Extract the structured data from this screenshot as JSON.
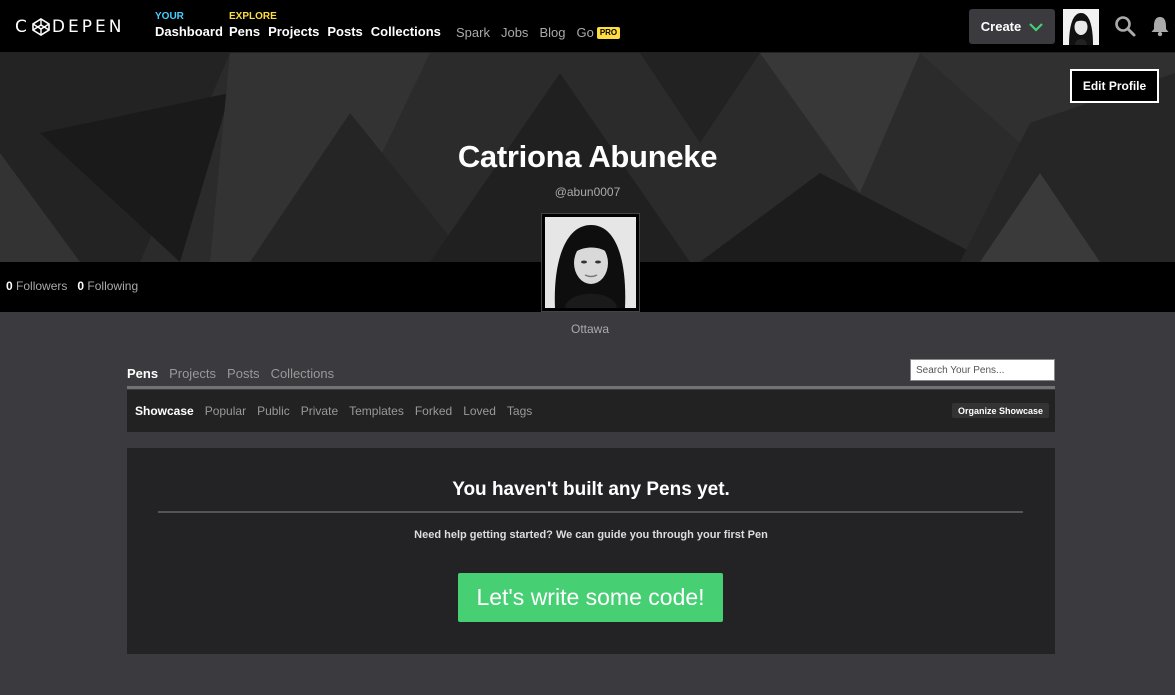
{
  "brand": {
    "logo_text_left": "C",
    "logo_text_right": "DEPEN"
  },
  "nav": {
    "your": {
      "kicker": "YOUR",
      "links": [
        "Dashboard"
      ]
    },
    "explore": {
      "kicker": "EXPLORE",
      "links": [
        "Pens",
        "Projects",
        "Posts",
        "Collections"
      ]
    },
    "secondary": [
      "Spark",
      "Jobs",
      "Blog",
      "Go"
    ],
    "pro_badge": "PRO",
    "create_label": "Create"
  },
  "profile": {
    "edit_label": "Edit Profile",
    "name": "Catriona Abuneke",
    "handle": "@abun0007",
    "followers_count": "0",
    "followers_label": "Followers",
    "following_count": "0",
    "following_label": "Following",
    "location": "Ottawa"
  },
  "content": {
    "tabs": [
      "Pens",
      "Projects",
      "Posts",
      "Collections"
    ],
    "active_tab": "Pens",
    "search_placeholder": "Search Your Pens...",
    "subtabs": [
      "Showcase",
      "Popular",
      "Public",
      "Private",
      "Templates",
      "Forked",
      "Loved",
      "Tags"
    ],
    "active_subtab": "Showcase",
    "organize_label": "Organize Showcase"
  },
  "empty_state": {
    "title": "You haven't built any Pens yet.",
    "help": "Need help getting started? We can guide you through your first Pen",
    "cta_label": "Let's write some code!"
  },
  "colors": {
    "accent_green": "#47cf73",
    "your_blue": "#47cfff",
    "explore_yellow": "#ffdd40"
  }
}
